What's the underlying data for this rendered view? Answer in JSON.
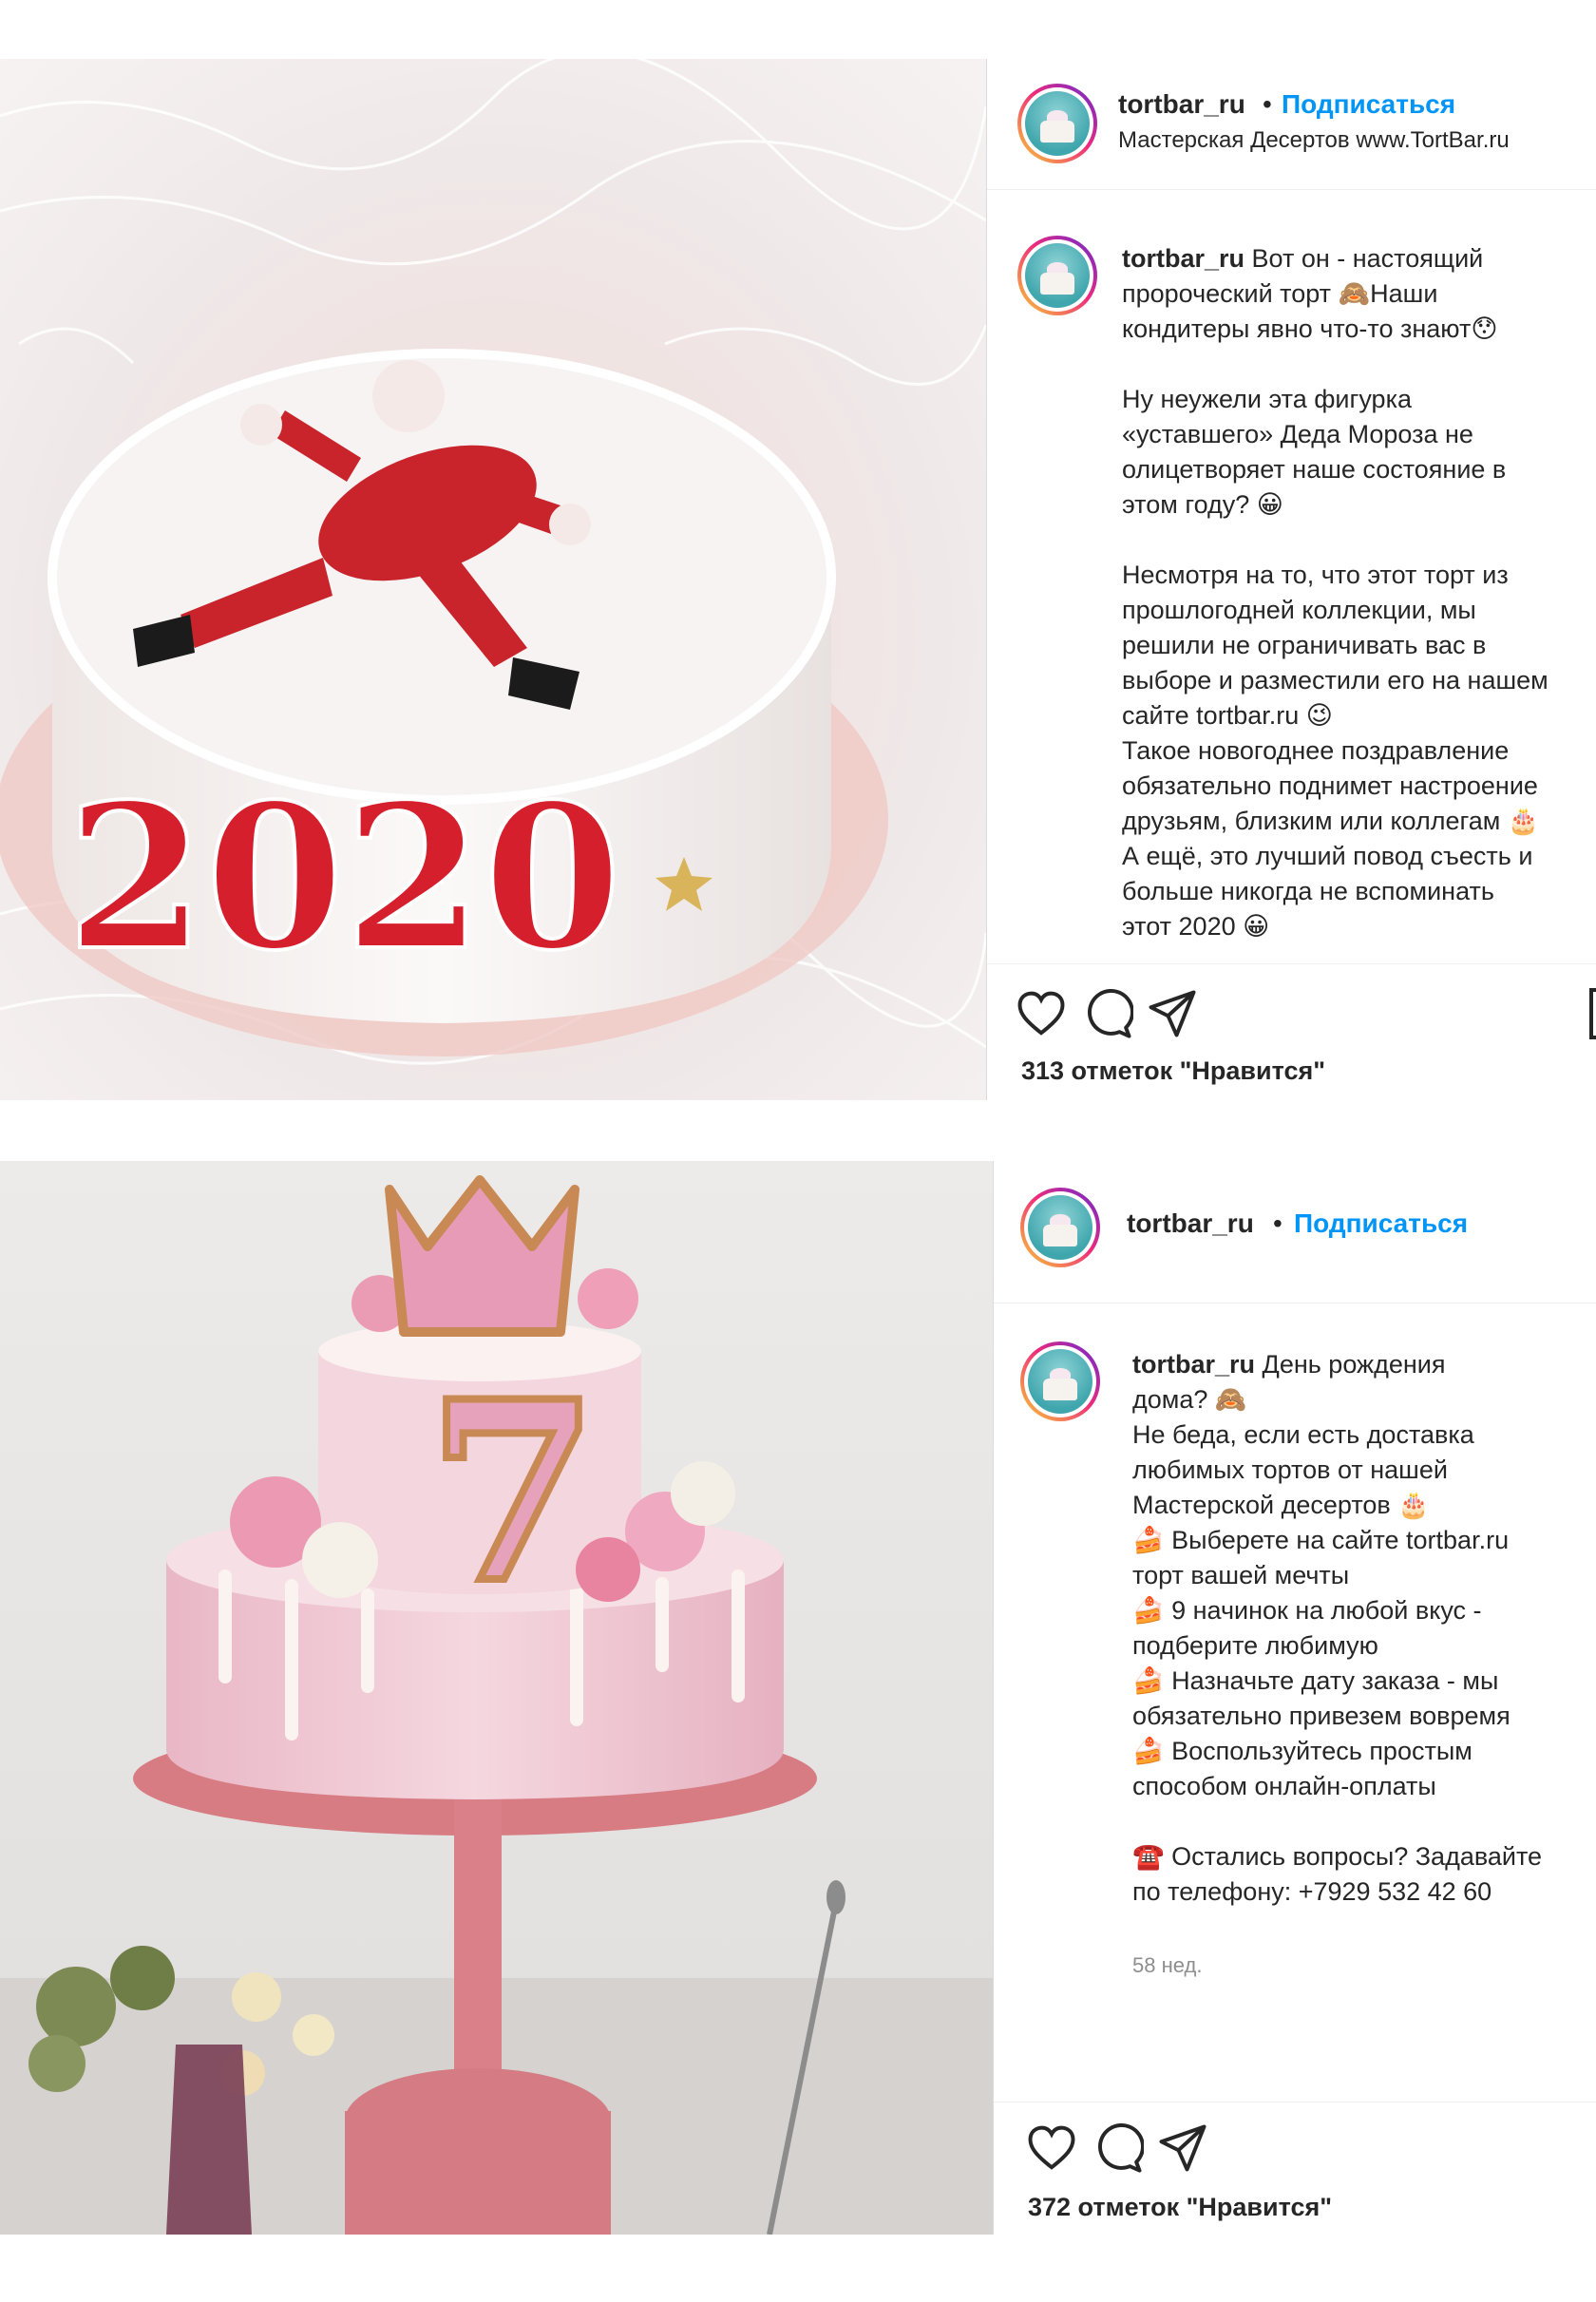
{
  "posts": [
    {
      "username": "tortbar_ru",
      "follow_label": "Подписаться",
      "bio": "Мастерская Десертов www.TortBar.ru",
      "caption_user": "tortbar_ru",
      "caption_text": "Вот он - настоящий\nпророческий торт 🙈Наши\nкондитеры явно что-то знают😯\n\nНу неужели эта фигурка\n«уставшего» Деда Мороза не\nолицетворяет наше состояние в\nэтом году? 😀\n\nНесмотря на то, что этот торт из\nпрошлогодней коллекции, мы\nрешили не ограничивать вас в\nвыборе и разместили его на нашем\nсайте tortbar.ru 😉\nТакое новогоднее поздравление\nобязательно поднимет настроение\nдрузьям, близким или коллегам 🎂\nА ещё, это лучший повод съесть и\nбольше никогда не вспоминать\nэтот 2020 😀",
      "likes": "313 отметок \"Нравится\"",
      "cake_number": "2020"
    },
    {
      "username": "tortbar_ru",
      "follow_label": "Подписаться",
      "caption_user": "tortbar_ru",
      "caption_text": "День рождения\nдома? 🙈\nНе беда, если есть доставка\nлюбимых тортов от нашей\nМастерской десертов 🎂\n🍰 Выберете на сайте tortbar.ru\nторт вашей мечты\n🍰 9 начинок на любой вкус -\nподберите любимую\n🍰 Назначьте дату заказа - мы\nобязательно привезем вовремя\n🍰 Воспользуйтесь простым\nспособом онлайн-оплаты\n\n☎️ Остались вопросы? Задавайте\nпо телефону: +7929 532 42 60",
      "time_ago": "58 нед.",
      "likes": "372 отметок \"Нравится\"",
      "cake_number": "7"
    }
  ],
  "icons": [
    "heart-icon",
    "comment-icon",
    "share-icon",
    "bookmark-icon"
  ],
  "colors": {
    "link": "#0095f6",
    "text": "#262626",
    "muted": "#8e8e8e",
    "border": "#dbdbdb"
  }
}
